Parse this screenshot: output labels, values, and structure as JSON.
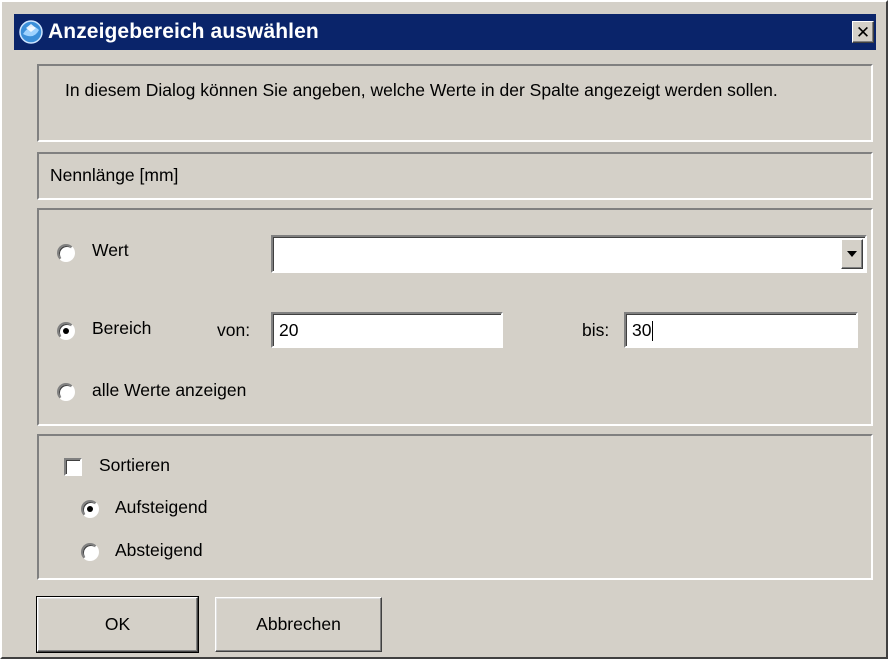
{
  "window": {
    "title": "Anzeigebereich auswählen",
    "close_glyph": "✕"
  },
  "info": {
    "text": "In diesem Dialog können Sie angeben, welche Werte in der Spalte angezeigt werden sollen."
  },
  "column": {
    "label": "Nennlänge [mm]"
  },
  "range": {
    "options": [
      {
        "label": "Wert",
        "selected": false
      },
      {
        "label": "Bereich",
        "selected": true
      },
      {
        "label": "alle Werte anzeigen",
        "selected": false
      }
    ],
    "wert_value": "",
    "von_label": "von:",
    "von_value": "20",
    "bis_label": "bis:",
    "bis_value": "30"
  },
  "sort": {
    "checkbox_label": "Sortieren",
    "checked": false,
    "options": [
      {
        "label": "Aufsteigend",
        "selected": true
      },
      {
        "label": "Absteigend",
        "selected": false
      }
    ]
  },
  "buttons": {
    "ok": "OK",
    "cancel": "Abbrechen"
  },
  "icons": {
    "app": "app-icon",
    "close": "close-icon",
    "dropdown": "chevron-down-icon"
  },
  "colors": {
    "titlebar": "#0a246a",
    "face": "#d4d0c8"
  }
}
